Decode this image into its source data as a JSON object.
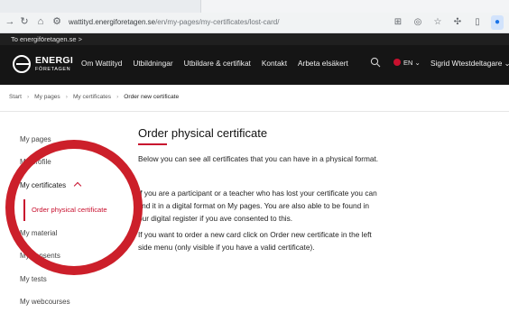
{
  "browser": {
    "url_host": "wattityd.energiforetagen.se",
    "url_path": "/en/my-pages/my-certificates/lost-card/"
  },
  "toplink": {
    "label": "To energiföretagen.se >"
  },
  "header": {
    "logo_top": "ENERGI",
    "logo_bottom": "FÖRETAGEN",
    "nav": [
      "Om Wattityd",
      "Utbildningar",
      "Utbildare & certifikat",
      "Kontakt",
      "Arbeta elsäkert"
    ],
    "language": "EN",
    "user": "Sigrid Wtestdeltagare"
  },
  "breadcrumb": {
    "items": [
      "Start",
      "My pages",
      "My certificates"
    ],
    "current": "Order new certificate"
  },
  "sidebar": {
    "items": [
      "My pages",
      "My profile",
      "My certificates",
      "My material",
      "My consents",
      "My tests",
      "My webcourses"
    ],
    "sub_item": "Order physical certificate"
  },
  "content": {
    "title": "Order physical certificate",
    "paragraphs": [
      "Below you can see all certificates that you can have in a physical format.",
      "If you are a participant or a teacher who has lost your certificate you can find it in a digital format on My pages. You are also able to be found in our digital register if you ave consented to this.",
      "If you want to order a new card click on Order new certificate in the left side menu (only visible if you have a valid certificate)."
    ]
  },
  "colors": {
    "accent": "#c8102e",
    "annotation": "#cc1f2a",
    "header_bg": "#151515"
  }
}
